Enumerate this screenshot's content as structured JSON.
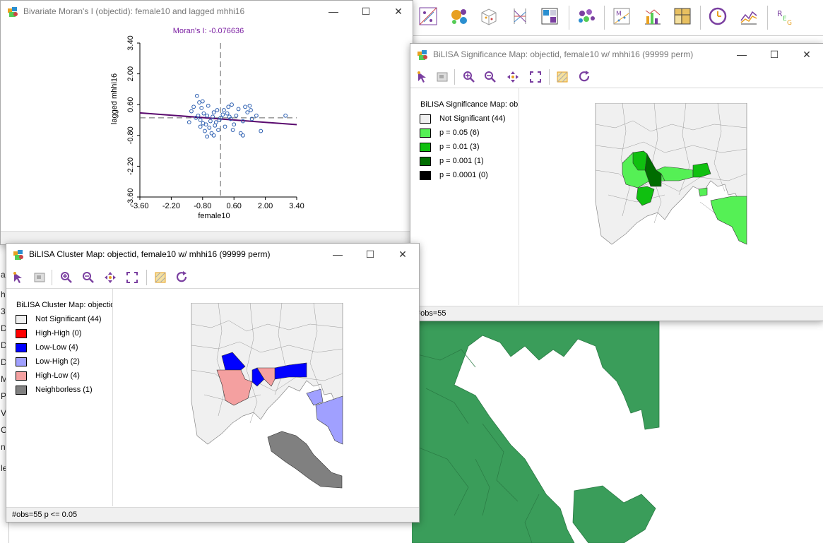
{
  "main_app": {
    "left_strip_letters": [
      "a",
      "h",
      "3",
      "D",
      "D",
      "D",
      "M",
      "P",
      "V",
      "C",
      "n",
      "le"
    ]
  },
  "moran_window": {
    "title": "Bivariate Moran's I (objectid): female10 and lagged mhhi16",
    "stat_label": "Moran's I: -0.076636",
    "xlabel": "female10",
    "ylabel": "lagged mhhi16",
    "controls": {
      "minimize": "—",
      "maximize": "☐",
      "close": "✕"
    }
  },
  "chart_data": {
    "type": "scatter",
    "title": "Moran's I: -0.076636",
    "xlabel": "female10",
    "ylabel": "lagged mhhi16",
    "xlim": [
      -3.6,
      3.4
    ],
    "ylim": [
      -3.6,
      3.4
    ],
    "xticks": [
      "-3.60",
      "-2.20",
      "-0.80",
      "0.60",
      "2.00",
      "3.40"
    ],
    "yticks": [
      "3.40",
      "2.00",
      "0.60",
      "-0.80",
      "-2.20",
      "-3.60"
    ],
    "points": [
      [
        -1.3,
        0.3
      ],
      [
        -1.2,
        0.5
      ],
      [
        -1.1,
        0.0
      ],
      [
        -1.05,
        1.0
      ],
      [
        -1.0,
        0.1
      ],
      [
        -0.95,
        0.7
      ],
      [
        -0.9,
        -0.1
      ],
      [
        -0.85,
        0.45
      ],
      [
        -0.8,
        0.75
      ],
      [
        -0.78,
        -0.25
      ],
      [
        -0.75,
        0.2
      ],
      [
        -0.7,
        -0.6
      ],
      [
        -0.65,
        -0.3
      ],
      [
        -0.6,
        0.1
      ],
      [
        -0.55,
        0.55
      ],
      [
        -0.5,
        -0.45
      ],
      [
        -0.45,
        -0.15
      ],
      [
        -0.4,
        -0.7
      ],
      [
        -0.35,
        0.05
      ],
      [
        -0.3,
        0.25
      ],
      [
        -0.25,
        -0.35
      ],
      [
        -0.2,
        -0.2
      ],
      [
        -0.15,
        0.35
      ],
      [
        -0.1,
        -0.55
      ],
      [
        0.0,
        0.0
      ],
      [
        0.1,
        0.15
      ],
      [
        0.2,
        -0.4
      ],
      [
        0.3,
        0.2
      ],
      [
        0.35,
        0.5
      ],
      [
        0.4,
        0.05
      ],
      [
        0.5,
        0.6
      ],
      [
        0.6,
        -0.3
      ],
      [
        0.7,
        0.1
      ],
      [
        0.8,
        0.4
      ],
      [
        0.9,
        -0.7
      ],
      [
        1.0,
        -0.15
      ],
      [
        1.1,
        0.5
      ],
      [
        1.2,
        0.25
      ],
      [
        1.3,
        0.55
      ],
      [
        1.4,
        -0.05
      ],
      [
        1.6,
        0.1
      ],
      [
        1.8,
        -0.6
      ],
      [
        -1.4,
        -0.2
      ],
      [
        -0.6,
        -0.85
      ],
      [
        0.15,
        0.35
      ],
      [
        0.55,
        -0.55
      ],
      [
        1.35,
        0.35
      ],
      [
        -0.3,
        -0.8
      ],
      [
        2.9,
        0.1
      ],
      [
        -0.05,
        -0.1
      ],
      [
        0.45,
        -0.05
      ],
      [
        1.0,
        -0.8
      ],
      [
        -0.9,
        -0.4
      ]
    ],
    "regression": {
      "slope": -0.076636,
      "intercept": -0.05
    },
    "colors": {
      "points": "#2a5db0",
      "line": "#5a0a6e",
      "stat": "#7b1fa2"
    }
  },
  "significance_window": {
    "title": "BiLISA Significance Map: objectid, female10 w/ mhhi16 (99999 perm)",
    "legend_title": "BiLISA Significance Map: ob",
    "legend_items": [
      {
        "label": "Not Significant (44)",
        "color": "#f0f0f0"
      },
      {
        "label": "p = 0.05 (6)",
        "color": "#55f055"
      },
      {
        "label": "p = 0.01 (3)",
        "color": "#10c010"
      },
      {
        "label": "p = 0.001 (1)",
        "color": "#006d00"
      },
      {
        "label": "p = 0.0001 (0)",
        "color": "#000000"
      }
    ],
    "status": "#obs=55",
    "controls": {
      "minimize": "—",
      "maximize": "☐",
      "close": "✕"
    }
  },
  "cluster_window": {
    "title": "BiLISA Cluster Map: objectid, female10 w/ mhhi16 (99999 perm)",
    "legend_title": "BiLISA Cluster Map: objectid",
    "legend_items": [
      {
        "label": "Not Significant (44)",
        "color": "#f0f0f0"
      },
      {
        "label": "High-High (0)",
        "color": "#ff0000"
      },
      {
        "label": "Low-Low (4)",
        "color": "#0000ff"
      },
      {
        "label": "Low-High (2)",
        "color": "#a0a0ff"
      },
      {
        "label": "High-Low (4)",
        "color": "#f4a0a0"
      },
      {
        "label": "Neighborless (1)",
        "color": "#808080"
      }
    ],
    "status": "#obs=55  p <= 0.05",
    "controls": {
      "minimize": "—",
      "maximize": "☐",
      "close": "✕"
    }
  },
  "colors": {
    "green_map": "#3a9d5a",
    "window_border": "#aaaaaa",
    "accent_purple": "#6a1b9a"
  }
}
